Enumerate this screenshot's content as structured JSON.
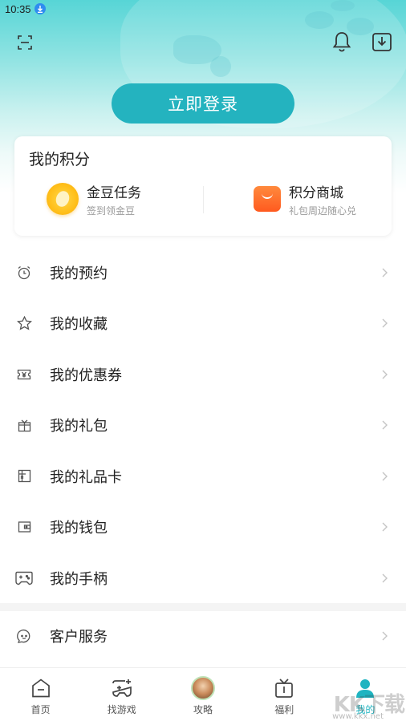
{
  "status_bar": {
    "time": "10:35"
  },
  "header": {
    "login_button": "立即登录"
  },
  "points": {
    "title": "我的积分",
    "items": [
      {
        "title": "金豆任务",
        "subtitle": "签到领金豆",
        "icon": "gold-coin-icon"
      },
      {
        "title": "积分商城",
        "subtitle": "礼包周边随心兑",
        "icon": "shopping-bag-icon"
      }
    ]
  },
  "menu": {
    "items": [
      {
        "label": "我的预约",
        "icon": "alarm-clock-icon"
      },
      {
        "label": "我的收藏",
        "icon": "star-icon"
      },
      {
        "label": "我的优惠券",
        "icon": "coupon-icon"
      },
      {
        "label": "我的礼包",
        "icon": "gift-icon"
      },
      {
        "label": "我的礼品卡",
        "icon": "gift-card-icon"
      },
      {
        "label": "我的钱包",
        "icon": "wallet-icon"
      },
      {
        "label": "我的手柄",
        "icon": "gamepad-icon"
      }
    ],
    "service": {
      "label": "客户服务",
      "icon": "customer-service-icon"
    }
  },
  "bottom_nav": {
    "items": [
      {
        "label": "首页",
        "icon": "home-icon"
      },
      {
        "label": "找游戏",
        "icon": "find-game-icon"
      },
      {
        "label": "攻略",
        "icon": "guide-avatar-icon"
      },
      {
        "label": "福利",
        "icon": "welfare-tv-icon"
      },
      {
        "label": "我的",
        "icon": "profile-icon",
        "active": true
      }
    ]
  },
  "watermark": {
    "main": "KK下载",
    "sub": "www.kkx.net"
  },
  "colors": {
    "accent": "#24b3bf",
    "active_tab": "#1fb4c1"
  }
}
